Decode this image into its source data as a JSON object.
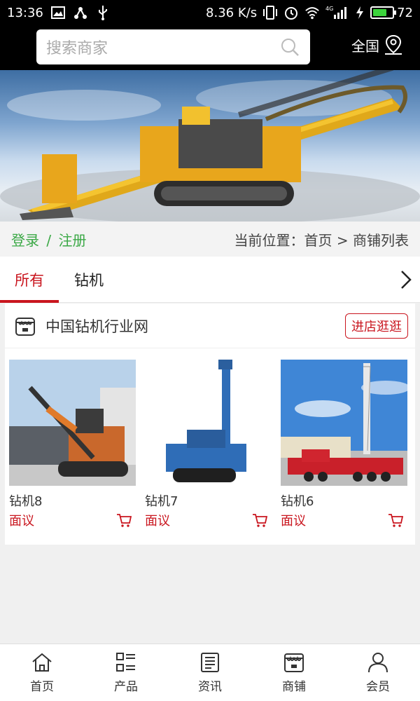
{
  "status_bar": {
    "time": "13:36",
    "speed": "8.36 K/s",
    "network": "4G",
    "battery": "72",
    "battery_level": 0.72
  },
  "search": {
    "placeholder": "搜索商家"
  },
  "region": {
    "label": "全国"
  },
  "breadcrumb": {
    "login": "登录",
    "separator": "/",
    "register": "注册",
    "location": "当前位置：首页 > 商铺列表"
  },
  "tabs": [
    {
      "label": "所有",
      "active": true
    },
    {
      "label": "钻机",
      "active": false
    }
  ],
  "shop": {
    "name": "中国钻机行业网",
    "enter_label": "进店逛逛"
  },
  "products": [
    {
      "name": "钻机8",
      "price": "面议"
    },
    {
      "name": "钻机7",
      "price": "面议"
    },
    {
      "name": "钻机6",
      "price": "面议"
    }
  ],
  "bottom_nav": [
    {
      "label": "首页",
      "icon": "home-icon"
    },
    {
      "label": "产品",
      "icon": "product-list-icon"
    },
    {
      "label": "资讯",
      "icon": "news-icon"
    },
    {
      "label": "商铺",
      "icon": "store-icon"
    },
    {
      "label": "会员",
      "icon": "user-icon"
    }
  ],
  "colors": {
    "accent": "#c9151e",
    "login_green": "#3aa845",
    "header_bg": "#000000"
  }
}
